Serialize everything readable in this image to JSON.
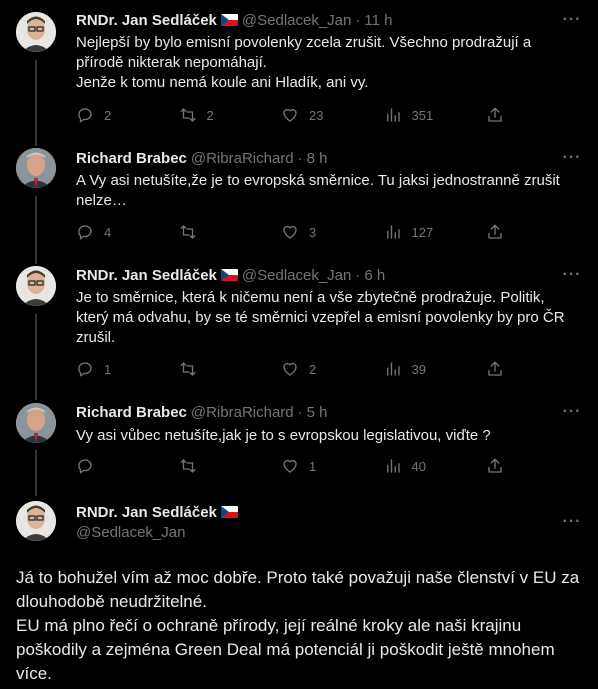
{
  "tweets": [
    {
      "name": "RNDr. Jan Sedláček",
      "handle": "@Sedlacek_Jan",
      "time": "11 h",
      "text": "Nejlepší by bylo emisní povolenky zcela zrušit. Všechno prodražují a přírodě nikterak nepomáhají.\nJenže k tomu nemá koule ani Hladík, ani vy.",
      "replies": "2",
      "retweets": "2",
      "likes": "23",
      "views": "351"
    },
    {
      "name": "Richard Brabec",
      "handle": "@RibraRichard",
      "time": "8 h",
      "text": "A Vy asi netušíte,že je to evropská směrnice. Tu jaksi jednostranně zrušit nelze…",
      "replies": "4",
      "retweets": "",
      "likes": "3",
      "views": "127"
    },
    {
      "name": "RNDr. Jan Sedláček",
      "handle": "@Sedlacek_Jan",
      "time": "6 h",
      "text": "Je to směrnice, která k ničemu není a vše zbytečně prodražuje. Politik, který má odvahu, by se té směrnici vzepřel a emisní povolenky by pro ČR zrušil.",
      "replies": "1",
      "retweets": "",
      "likes": "2",
      "views": "39"
    },
    {
      "name": "Richard Brabec",
      "handle": "@RibraRichard",
      "time": "5 h",
      "text": "Vy asi vůbec netušíte,jak je to s evropskou legislativou, viďte ?",
      "replies": "",
      "retweets": "",
      "likes": "1",
      "views": "40"
    }
  ],
  "main": {
    "name": "RNDr. Jan Sedláček",
    "handle": "@Sedlacek_Jan",
    "text": "Já to bohužel vím až moc dobře. Proto také považuji naše členství v EU za dlouhodobě neudržitelné.\nEU má plno řečí o ochraně přírody, její reálné kroky ale naši krajinu poškodily a zejména Green Deal má potenciál ji poškodit ještě mnohem více."
  },
  "symbols": {
    "dot": "·",
    "more": "···"
  },
  "colors": {
    "background": "#000000",
    "text": "#e7e9ea",
    "secondary": "#71767b",
    "divider": "#2f3336"
  }
}
